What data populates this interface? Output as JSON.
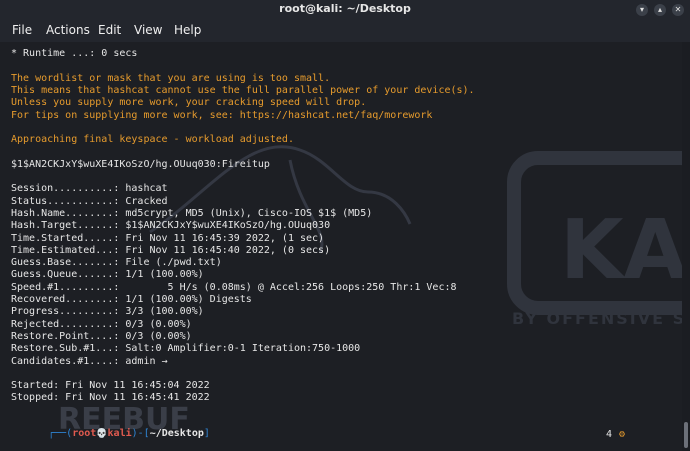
{
  "window": {
    "title": "root@kali: ~/Desktop"
  },
  "menu": [
    "File",
    "Actions",
    "Edit",
    "View",
    "Help"
  ],
  "watermark": {
    "brand": "KALI",
    "tagline": "BY OFFENSIVE S",
    "freebuf": "REEBUF"
  },
  "terminal": {
    "lines": [
      {
        "text": "* Runtime ...: 0 secs",
        "style": "normal"
      },
      {
        "text": "",
        "style": "normal"
      },
      {
        "text": "The wordlist or mask that you are using is too small.",
        "style": "orange"
      },
      {
        "text": "This means that hashcat cannot use the full parallel power of your device(s).",
        "style": "orange"
      },
      {
        "text": "Unless you supply more work, your cracking speed will drop.",
        "style": "orange"
      },
      {
        "text": "For tips on supplying more work, see: https://hashcat.net/faq/morework",
        "style": "orange"
      },
      {
        "text": "",
        "style": "normal"
      },
      {
        "text": "Approaching final keyspace - workload adjusted.",
        "style": "orange"
      },
      {
        "text": "",
        "style": "normal"
      },
      {
        "text": "$1$AN2CKJxY$wuXE4IKoSzO/hg.OUuq030:Fireitup",
        "style": "normal"
      },
      {
        "text": "",
        "style": "normal"
      },
      {
        "text": "Session..........: hashcat",
        "style": "normal"
      },
      {
        "text": "Status...........: Cracked",
        "style": "normal"
      },
      {
        "text": "Hash.Name........: md5crypt, MD5 (Unix), Cisco-IOS $1$ (MD5)",
        "style": "normal"
      },
      {
        "text": "Hash.Target......: $1$AN2CKJxY$wuXE4IKoSzO/hg.OUuq030",
        "style": "normal"
      },
      {
        "text": "Time.Started.....: Fri Nov 11 16:45:39 2022, (1 sec)",
        "style": "normal"
      },
      {
        "text": "Time.Estimated...: Fri Nov 11 16:45:40 2022, (0 secs)",
        "style": "normal"
      },
      {
        "text": "Guess.Base.......: File (./pwd.txt)",
        "style": "normal"
      },
      {
        "text": "Guess.Queue......: 1/1 (100.00%)",
        "style": "normal"
      },
      {
        "text": "Speed.#1.........:        5 H/s (0.08ms) @ Accel:256 Loops:250 Thr:1 Vec:8",
        "style": "normal"
      },
      {
        "text": "Recovered........: 1/1 (100.00%) Digests",
        "style": "normal"
      },
      {
        "text": "Progress.........: 3/3 (100.00%)",
        "style": "normal"
      },
      {
        "text": "Rejected.........: 0/3 (0.00%)",
        "style": "normal"
      },
      {
        "text": "Restore.Point....: 0/3 (0.00%)",
        "style": "normal"
      },
      {
        "text": "Restore.Sub.#1...: Salt:0 Amplifier:0-1 Iteration:750-1000",
        "style": "normal"
      },
      {
        "text": "Candidates.#1....: admin →",
        "style": "normal"
      },
      {
        "text": "",
        "style": "normal"
      },
      {
        "text": "Started: Fri Nov 11 16:45:04 2022",
        "style": "normal"
      },
      {
        "text": "Stopped: Fri Nov 11 16:45:41 2022",
        "style": "normal"
      }
    ],
    "prompt": {
      "open": "┌──(",
      "user": "root",
      "skull": "💀",
      "host": "kali",
      "mid": ")-[",
      "path": "~/Desktop",
      "close": "]"
    },
    "status": {
      "jobs": "4",
      "icon": "gear-icon"
    }
  },
  "colors": {
    "background": "#1d1f24",
    "orange": "#e69b2d",
    "prompt_red": "#e05a4f",
    "prompt_blue": "#2f86d6",
    "path_blue": "#5aa7f0",
    "text": "#e6e6e6"
  }
}
